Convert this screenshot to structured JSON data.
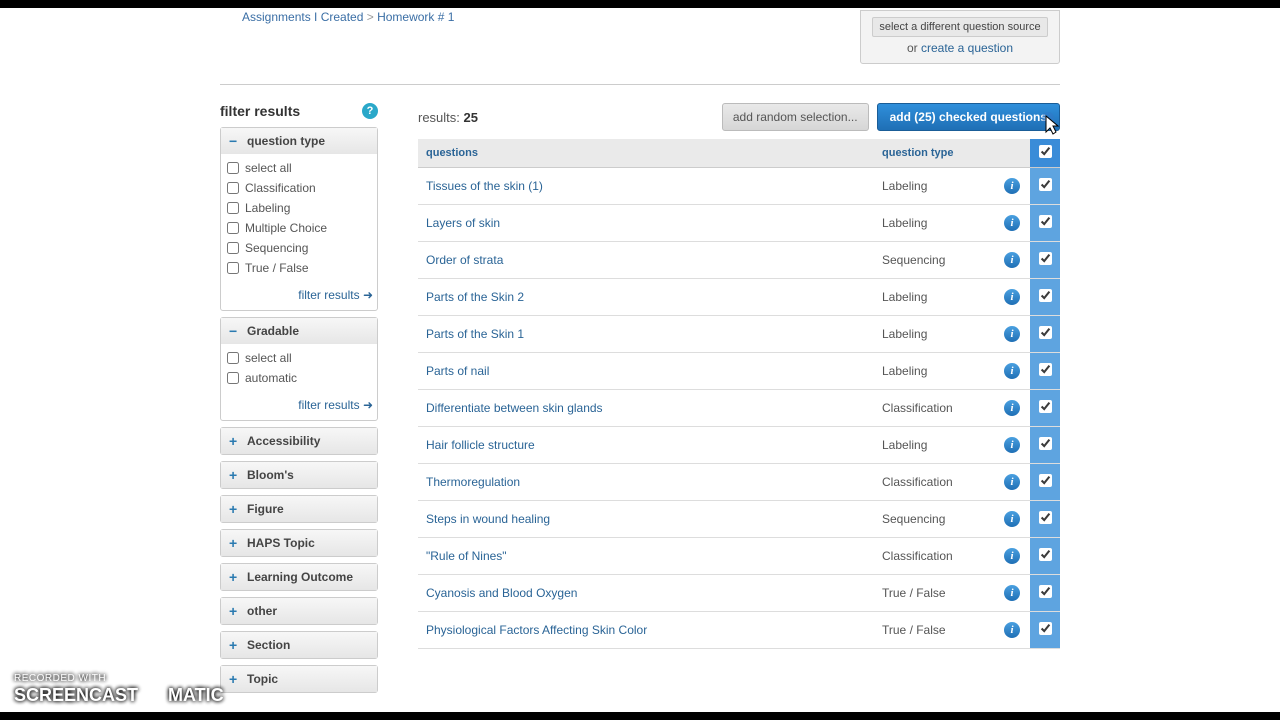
{
  "breadcrumb": {
    "part1": "Assignments I Created",
    "sep": " > ",
    "part2": "Homework # 1"
  },
  "sourceBox": {
    "button": "select a different question source",
    "or": "or",
    "link": "create a question"
  },
  "sidebar": {
    "title": "filter results",
    "panels": {
      "questionType": {
        "label": "question type",
        "items": [
          "select all",
          "Classification",
          "Labeling",
          "Multiple Choice",
          "Sequencing",
          "True / False"
        ],
        "filterLink": "filter results"
      },
      "gradable": {
        "label": "Gradable",
        "items": [
          "select all",
          "automatic"
        ],
        "filterLink": "filter results"
      },
      "collapsed": [
        "Accessibility",
        "Bloom's",
        "Figure",
        "HAPS Topic",
        "Learning Outcome",
        "other",
        "Section",
        "Topic"
      ]
    }
  },
  "results": {
    "label": "results:",
    "count": "25",
    "addRandom": "add random selection...",
    "addChecked": "add (25) checked questions"
  },
  "table": {
    "headers": {
      "questions": "questions",
      "type": "question type"
    },
    "rows": [
      {
        "name": "Tissues of the skin (1)",
        "type": "Labeling"
      },
      {
        "name": "Layers of skin",
        "type": "Labeling"
      },
      {
        "name": "Order of strata",
        "type": "Sequencing"
      },
      {
        "name": "Parts of the Skin 2",
        "type": "Labeling"
      },
      {
        "name": "Parts of the Skin 1",
        "type": "Labeling"
      },
      {
        "name": "Parts of nail",
        "type": "Labeling"
      },
      {
        "name": "Differentiate between skin glands",
        "type": "Classification"
      },
      {
        "name": "Hair follicle structure",
        "type": "Labeling"
      },
      {
        "name": "Thermoregulation",
        "type": "Classification"
      },
      {
        "name": "Steps in wound healing",
        "type": "Sequencing"
      },
      {
        "name": "\"Rule of Nines\"",
        "type": "Classification"
      },
      {
        "name": "Cyanosis and Blood Oxygen",
        "type": "True / False"
      },
      {
        "name": "Physiological Factors Affecting Skin Color",
        "type": "True / False"
      }
    ]
  },
  "watermark": {
    "small": "RECORDED WITH",
    "brand1": "SCREENCAST",
    "brand2": "MATIC"
  }
}
